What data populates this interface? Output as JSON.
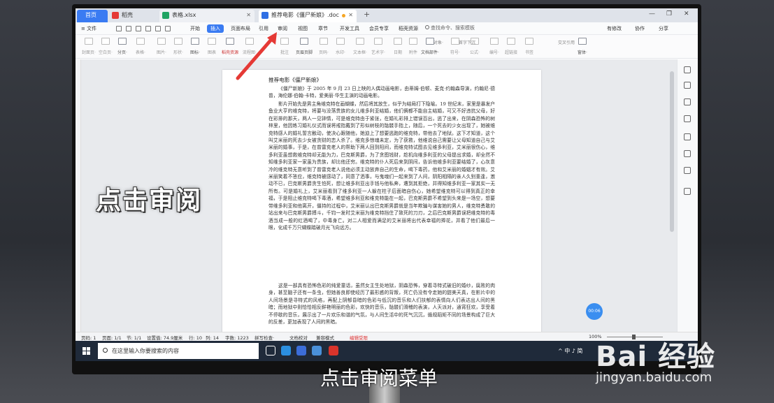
{
  "tabs": {
    "home": "首页",
    "daoke": "稻壳",
    "xlsx": "表格.xlsx",
    "doc": "推荐电影《僵尸新娘》.doc",
    "add": "+"
  },
  "window_controls": {
    "min": "—",
    "max": "❐",
    "close": "✕"
  },
  "menu": {
    "file": "文件",
    "items": [
      "开始",
      "插入",
      "页面布局",
      "引用",
      "审阅",
      "视图",
      "章节",
      "开发工具",
      "会员专享",
      "稻壳资源"
    ],
    "active": "插入",
    "search": "查找命令、搜索模板",
    "right": [
      "有修改",
      "协作",
      "分享"
    ]
  },
  "ribbon": [
    {
      "label": "封面页·",
      "dim": true
    },
    {
      "label": "空白页·",
      "dim": true
    },
    {
      "label": "分页·",
      "dim": false
    },
    {
      "label": "表格·",
      "dim": true
    },
    {
      "label": "图片·",
      "dim": true
    },
    {
      "label": "形状·",
      "dim": true
    },
    {
      "label": "图标·",
      "dim": false
    },
    {
      "label": "图表",
      "dim": true
    },
    {
      "label": "稻壳资源",
      "dim": false,
      "hot": true
    },
    {
      "label": "流程图·",
      "dim": true
    },
    {
      "label": "批注",
      "dim": true
    },
    {
      "label": "页眉页脚",
      "dim": false
    },
    {
      "label": "页码·",
      "dim": true
    },
    {
      "label": "水印·",
      "dim": true
    },
    {
      "label": "文本框·",
      "dim": true
    },
    {
      "label": "艺术字·",
      "dim": true
    },
    {
      "label": "日期",
      "dim": true
    },
    {
      "label": "附件",
      "dim": true
    },
    {
      "label": "文档部件·",
      "dim": false
    },
    {
      "label": "符号·",
      "dim": true
    },
    {
      "label": "公式·",
      "dim": true
    },
    {
      "label": "编号·",
      "dim": true
    },
    {
      "label": "超链接",
      "dim": true
    },
    {
      "label": "书签",
      "dim": true
    },
    {
      "label": "窗体·",
      "dim": false
    }
  ],
  "ribbon_small": {
    "object": "对象·",
    "firstcap": "首字下沉",
    "crossref": "交叉引用"
  },
  "document": {
    "title": "推荐电影《僵尸新娘》",
    "para1": "《僵尸新娘》于 2005 年 9 月 23 日上映的人偶动画电影，由蒂姆·伯顿、麦克·约翰森导演，约翰尼·德普，海伦娜·伯翰·卡特，爱美丽·华生主演的动画电影。",
    "para2": "影片开始先是男主角维克特在画蝴蝶，然后将其放生，似乎为结局打下隐喻。19 世纪末，家里是暴发户鱼业大亨的维克特，将要与没落贵族的女儿维多利亚结婚，他们俩都不能自主结婚，可又不好违抗父母，好在彩排的那天，两人一见钟情，可是维克特由于紧张，在婚礼彩排上错误百出，逃了出来，在阴森恐怖的树林里，他因练习婚礼仪式而误将戒指戴到了形似树枝的骷髅手指上，随后，一个死去的少女出现了，她被维克特感人的婚礼誓言触动，使决心跟随他，她迫上了想要逃跑的维克特，带他去了地狱。这下才知道，这个叫艾米丽的死去少女被贪财的恋人杀了。维克多惊魂未定，为了获救，他维说自己需要让父母知道自己与艾米丽的婚事，于是，在普雷克老人的帮助下两人回到阳间，而维克特试图去见维多利亚，艾米丽很伤心，维多利亚虽想救维克特却无能为力，巴克斯男爵，为了贪图钱财，趁机向维多利亚的父母提出求婚，却全然不知维多利亚家一家虽为贵族，却比他还穷。维克特的仆人死后来到阴间，告诉他维多利亚要结婚了，心灰意冷的维克特无意听到了普雷克老人说他必须主动放弃自己的生命，喝下毒药，他和艾米丽的婚姻才有效。艾米丽笑着不答应，维克特被感动了，同意了洒事，与鬼魂们一起来到了人间，阴阳相隔的亲人久别重逢，激动不已，巴克斯男爵贪生怕死，想让维多利亚出手钱与他私奔，遭到其拒绝，并得知维多利亚一家其实一无所有。可是婚礼上，艾米丽看到了维多利亚一人躲在柱子后面暗自伤心，她希望维克特可以得到真正的幸福，于是阻止维克特喝下毒酒，希望维多利亚和维克特能在一起，巴克斯男爵不希望到头来是一场空，想要带维多利亚和他离开，僵持的过程中，艾米丽认出巴克斯男爵就是当年欺骗与谋害她的男人，维克特勇敢的站出来与巴克斯男爵搏斗，千钧一发时艾米丽为维克特挡住了致死的刀刃，之后巴克斯男爵误把维克特的毒酒当成一般的红酒喝了，中毒身亡。对二人相爱而满足的艾米丽将出代表幸福的捧花，并看了他们最后一眼，化成千万只蝴蝶踏破月光飞向远方。",
    "para3": "这是一部具有恐怖色彩的纯爱童话，虽然女主生处地狱，阴森恐怖，穿着寻特式破旧的婚纱，腐败的肉身，甚至脑子还有一条虫，但她善良即使经历了最形惑的背叛，死亡仍没有令走她的甜美天真，在影片中的人间场景是寻特式的风格，再配上阴郁昏暗的色彩与低沉的音乐和人们扶郁的表情向人们表达出人间的黑暗；而地狱中则恰恰相反鲜艳明丽的色彩，欢快的音乐，骷髅们滑稽的表演，人天派对，通宵狂欢，享受着不停歇的音乐，展示出了一片欢乐和谐的气氛，与人间生活中的死气沉沉，循规蹈矩不同的场景构成了巨大的反差，更加表现了人间的黑暗。"
  },
  "timer": "00:06",
  "status": {
    "page": "页码: 1",
    "pages": "页面: 1/1",
    "section": "节: 1/1",
    "setting": "设置值: 74.9厘米",
    "row": "行: 10",
    "col": "列: 14",
    "words": "字数: 1223",
    "spell": "拼写检查·",
    "proof": "文档校对",
    "compat": "兼容模式",
    "lost": "编辑受限",
    "zoom": "100%"
  },
  "taskbar": {
    "search_placeholder": "在这里输入你要搜索的内容",
    "tray": "^ 中 ♪ 简"
  },
  "overlay": {
    "step": "点击审阅",
    "caption": "点击审阅菜单",
    "watermark_logo": "Bai 经验",
    "watermark_url": "jingyan.baidu.com"
  },
  "colors": {
    "accent": "#3a7bf2",
    "arrow": "#e53935"
  }
}
